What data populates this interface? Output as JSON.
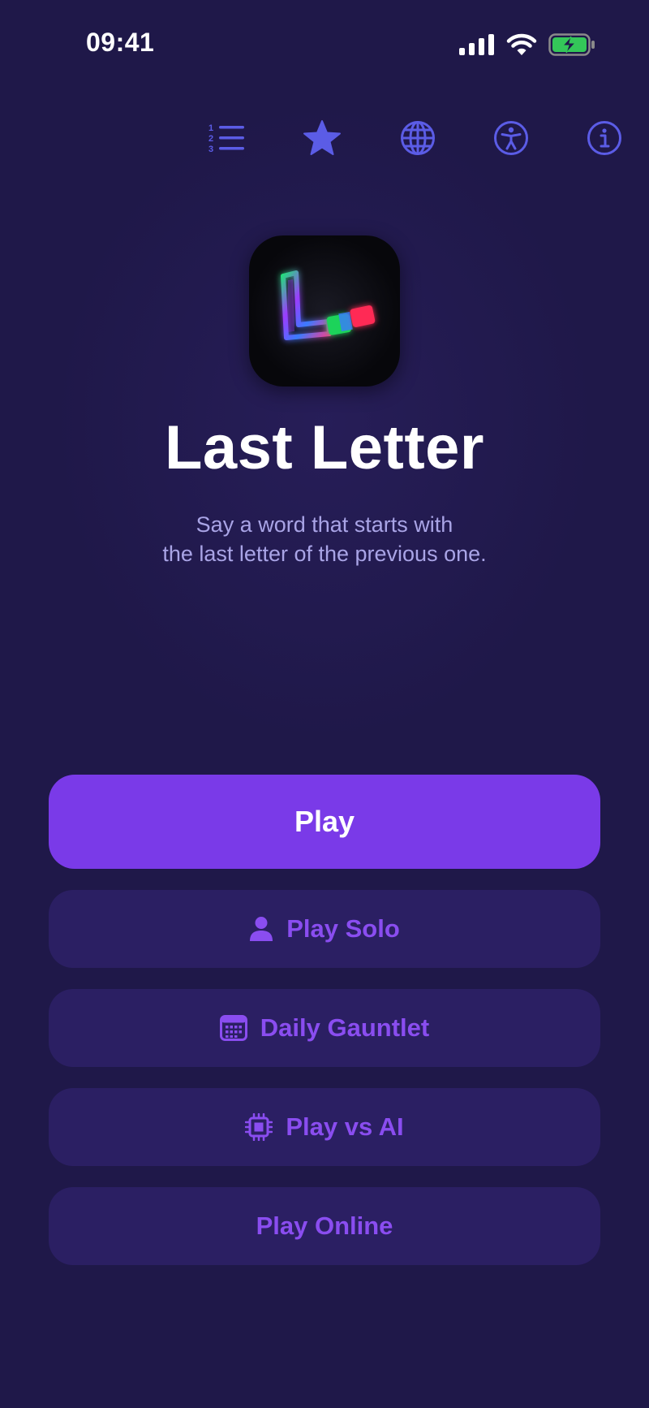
{
  "status_bar": {
    "time": "09:41"
  },
  "toolbar": {
    "items": [
      {
        "name": "leaderboard",
        "icon": "numbered-list-icon"
      },
      {
        "name": "favorites",
        "icon": "star-icon"
      },
      {
        "name": "language",
        "icon": "globe-icon"
      },
      {
        "name": "accessibility",
        "icon": "accessibility-icon"
      },
      {
        "name": "info",
        "icon": "info-icon"
      }
    ]
  },
  "hero": {
    "title": "Last Letter",
    "tagline_line1": "Say a word that starts with",
    "tagline_line2": "the last letter of the previous one."
  },
  "menu": {
    "play_label": "Play",
    "play_solo_label": "Play Solo",
    "daily_gauntlet_label": "Daily Gauntlet",
    "play_vs_ai_label": "Play vs AI",
    "play_online_label": "Play Online"
  },
  "colors": {
    "background": "#1f1849",
    "accent": "#7a3ae8",
    "secondary_button": "#2b1f63",
    "secondary_text": "#8a4df0",
    "toolbar_icon": "#5b5ce6",
    "tagline": "#a9a4e6",
    "battery": "#34c759"
  }
}
